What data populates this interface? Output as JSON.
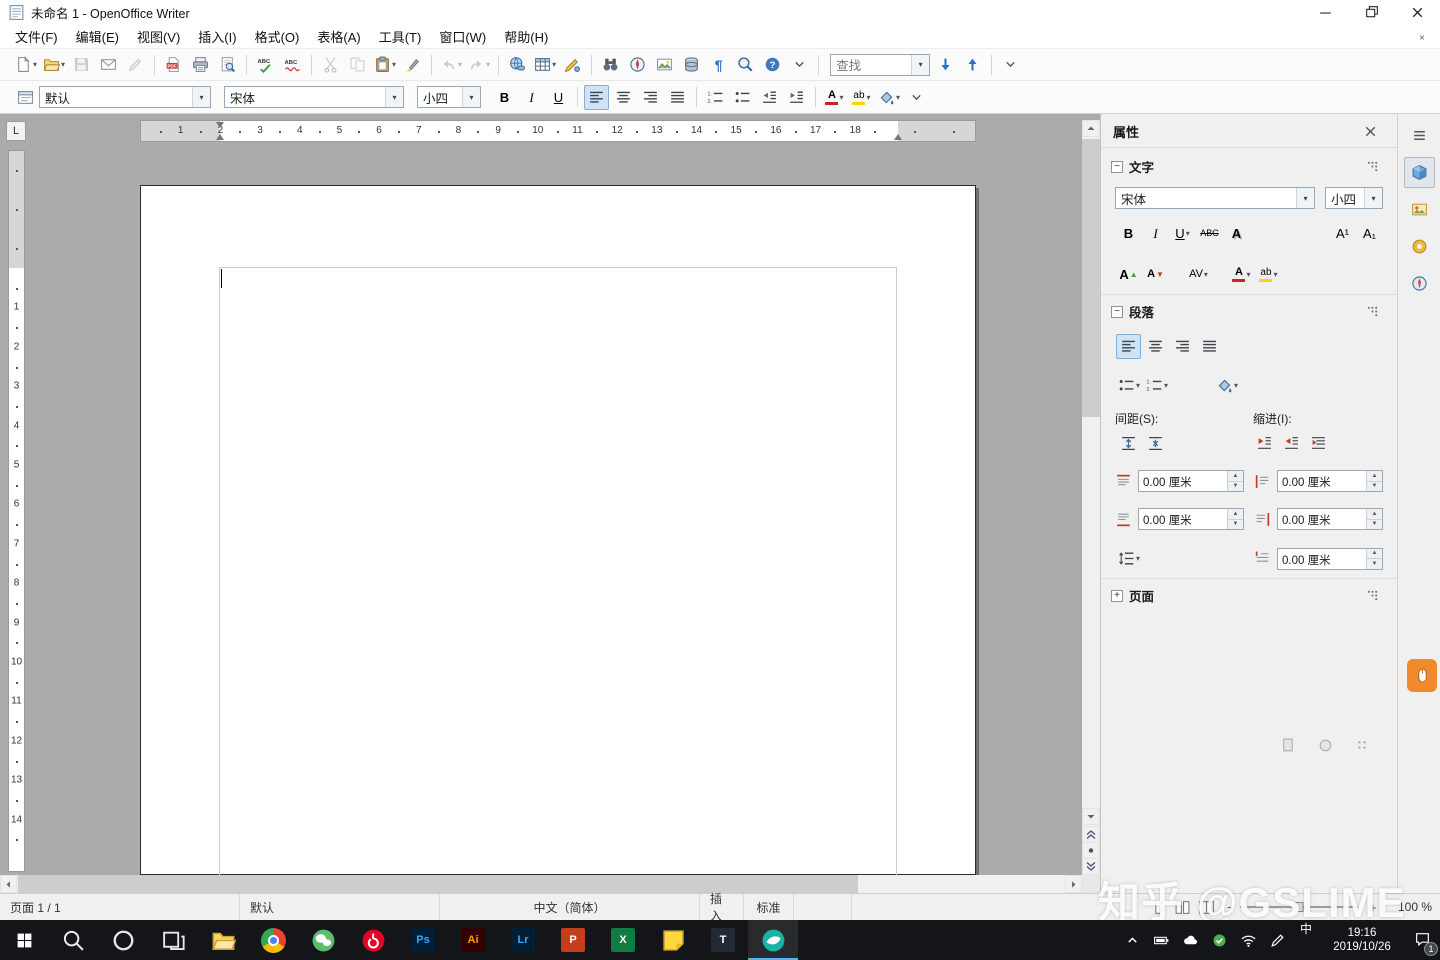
{
  "titlebar": {
    "title": "未命名 1 - OpenOffice Writer"
  },
  "menubar": {
    "items": [
      "文件(F)",
      "编辑(E)",
      "视图(V)",
      "插入(I)",
      "格式(O)",
      "表格(A)",
      "工具(T)",
      "窗口(W)",
      "帮助(H)"
    ]
  },
  "standard_toolbar": {
    "find_placeholder": "查找",
    "buttons": [
      {
        "name": "new-document-button",
        "glyph": "newdoc",
        "dropdown": true
      },
      {
        "name": "open-button",
        "glyph": "open",
        "dropdown": true
      },
      {
        "name": "save-button",
        "glyph": "save",
        "disabled": true
      },
      {
        "name": "email-document-button",
        "glyph": "email"
      },
      {
        "name": "edit-file-button",
        "glyph": "editfile",
        "disabled": true
      },
      {
        "sep": true
      },
      {
        "name": "export-pdf-button",
        "glyph": "pdf"
      },
      {
        "name": "print-button",
        "glyph": "print"
      },
      {
        "name": "page-preview-button",
        "glyph": "preview"
      },
      {
        "sep": true
      },
      {
        "name": "spelling-button",
        "glyph": "spell"
      },
      {
        "name": "autospellcheck-button",
        "glyph": "autospell"
      },
      {
        "sep": true
      },
      {
        "name": "cut-button",
        "glyph": "cut",
        "disabled": true
      },
      {
        "name": "copy-button",
        "glyph": "copy",
        "disabled": true
      },
      {
        "name": "paste-button",
        "glyph": "paste",
        "dropdown": true
      },
      {
        "name": "format-paintbrush-button",
        "glyph": "brush"
      },
      {
        "sep": true
      },
      {
        "name": "undo-button",
        "glyph": "undo",
        "dropdown": true,
        "disabled": true
      },
      {
        "name": "redo-button",
        "glyph": "redo",
        "dropdown": true,
        "disabled": true
      },
      {
        "sep": true
      },
      {
        "name": "hyperlink-button",
        "glyph": "hyperlink"
      },
      {
        "name": "table-button",
        "glyph": "table",
        "dropdown": true
      },
      {
        "name": "draw-functions-button",
        "glyph": "draw"
      },
      {
        "sep": true
      },
      {
        "name": "find-replace-button",
        "glyph": "binoculars"
      },
      {
        "name": "navigator-button",
        "glyph": "navigator"
      },
      {
        "name": "gallery-button",
        "glyph": "gallery"
      },
      {
        "name": "data-sources-button",
        "glyph": "datasource"
      },
      {
        "name": "formatting-marks-button",
        "glyph": "pilcrow"
      },
      {
        "name": "zoom-button",
        "glyph": "zoom"
      },
      {
        "name": "help-button",
        "glyph": "help"
      },
      {
        "name": "toolbar-overflow-button",
        "glyph": "chevdown"
      },
      {
        "sep": true
      }
    ]
  },
  "formatting_toolbar": {
    "style_value": "默认",
    "font_value": "宋体",
    "size_value": "小四",
    "buttons": [
      {
        "name": "bold-button",
        "glyph": "bold"
      },
      {
        "name": "italic-button",
        "glyph": "italic"
      },
      {
        "name": "underline-button",
        "glyph": "underline"
      },
      {
        "sep": true
      },
      {
        "name": "align-left-button",
        "glyph": "alignleft",
        "active": true
      },
      {
        "name": "align-center-button",
        "glyph": "aligncenter"
      },
      {
        "name": "align-right-button",
        "glyph": "alignright"
      },
      {
        "name": "align-justify-button",
        "glyph": "alignjustify"
      },
      {
        "sep": true
      },
      {
        "name": "numbering-button",
        "glyph": "numlist"
      },
      {
        "name": "bullets-button",
        "glyph": "bullist"
      },
      {
        "name": "decrease-indent-button",
        "glyph": "outdent"
      },
      {
        "name": "increase-indent-button",
        "glyph": "indent"
      },
      {
        "sep": true
      },
      {
        "name": "font-color-button",
        "glyph": "fontcolor",
        "dropdown": true
      },
      {
        "name": "highlighting-button",
        "glyph": "highlight",
        "dropdown": true
      },
      {
        "name": "background-color-button",
        "glyph": "bgcolor",
        "dropdown": true
      },
      {
        "name": "toolbar-overflow-button",
        "glyph": "chevdown"
      }
    ]
  },
  "ruler": {
    "h_numbers": [
      1,
      2,
      3,
      4,
      5,
      6,
      7,
      8,
      9,
      10,
      11,
      12,
      13,
      14,
      15,
      16,
      17,
      18
    ],
    "v_numbers": [
      1,
      2,
      3,
      4,
      5,
      6,
      7,
      8,
      9,
      10,
      11,
      12,
      13,
      14
    ],
    "tabstop_label": "L"
  },
  "sidebar": {
    "title": "属性",
    "character": {
      "title": "文字",
      "font_value": "宋体",
      "size_value": "小四",
      "row1": [
        {
          "name": "bold-button",
          "glyph": "bold"
        },
        {
          "name": "italic-button",
          "glyph": "italic"
        },
        {
          "name": "underline-button",
          "glyph": "underline",
          "dropdown": true
        },
        {
          "name": "strikethrough-button",
          "glyph": "strike"
        },
        {
          "name": "shadow-button",
          "glyph": "shadowA"
        }
      ],
      "row1_right": [
        {
          "name": "superscript-button",
          "glyph": "sup"
        },
        {
          "name": "subscript-button",
          "glyph": "sub"
        }
      ],
      "row2": [
        {
          "name": "increase-font-size-button",
          "glyph": "fontup"
        },
        {
          "name": "decrease-font-size-button",
          "glyph": "fontdown"
        }
      ],
      "row2_spacing": [
        {
          "name": "character-spacing-button",
          "glyph": "spacingAV",
          "dropdown": true
        }
      ],
      "row2_color": [
        {
          "name": "font-color-button",
          "glyph": "fontcolor",
          "dropdown": true
        },
        {
          "name": "highlighting-button",
          "glyph": "highlight",
          "dropdown": true
        }
      ]
    },
    "paragraph": {
      "title": "段落",
      "spacing_label": "间距(S):",
      "indent_label": "缩进(I):",
      "align_row": [
        {
          "name": "align-left-button",
          "glyph": "alignleft",
          "active": true
        },
        {
          "name": "align-center-button",
          "glyph": "aligncenter"
        },
        {
          "name": "align-right-button",
          "glyph": "alignright"
        },
        {
          "name": "align-justify-button",
          "glyph": "alignjustify"
        }
      ],
      "list_row": [
        {
          "name": "bullets-button",
          "glyph": "bullist",
          "dropdown": true
        },
        {
          "name": "numbering-button",
          "glyph": "numlist",
          "dropdown": true
        }
      ],
      "bg_row": [
        {
          "name": "paragraph-background-button",
          "glyph": "bgcolor",
          "dropdown": true
        }
      ],
      "spacing_buttons": [
        {
          "name": "increase-paragraph-spacing-button",
          "glyph": "incspace"
        },
        {
          "name": "decrease-paragraph-spacing-button",
          "glyph": "decspace"
        }
      ],
      "indent_buttons": [
        {
          "name": "increase-indent-button",
          "glyph": "indent2"
        },
        {
          "name": "decrease-indent-button",
          "glyph": "outdent2"
        },
        {
          "name": "hanging-indent-button",
          "glyph": "hangindent"
        }
      ],
      "above_spacing_value": "0.00 厘米",
      "below_spacing_value": "0.00 厘米",
      "before_indent_value": "0.00 厘米",
      "after_indent_value": "0.00 厘米",
      "first_line_indent_value": "0.00 厘米"
    },
    "page": {
      "title": "页面"
    }
  },
  "tabstrip": [
    {
      "name": "sidebar-settings-button",
      "glyph": "menu"
    },
    {
      "name": "properties-tab",
      "glyph": "cube",
      "active": true
    },
    {
      "name": "gallery-tab",
      "glyph": "galleryTab"
    },
    {
      "name": "styles-tab",
      "glyph": "stylesTab"
    },
    {
      "name": "navigator-tab",
      "glyph": "compass"
    }
  ],
  "statusbar": {
    "page": "页面 1 / 1",
    "style": "默认",
    "language": "中文（简体）",
    "insert_mode": "插入",
    "selection_mode": "标准",
    "zoom_value": "100 %"
  },
  "watermark": {
    "text": "知乎 @GSLIME"
  },
  "taskbar": {
    "apps": [
      {
        "name": "taskbar-search",
        "kind": "search"
      },
      {
        "name": "taskbar-cortana",
        "kind": "cortana"
      },
      {
        "name": "taskbar-task-view",
        "kind": "taskview"
      },
      {
        "name": "taskbar-file-explorer",
        "kind": "explorer"
      },
      {
        "name": "taskbar-chrome",
        "kind": "chrome"
      },
      {
        "name": "taskbar-wechat",
        "kind": "wechat"
      },
      {
        "name": "taskbar-netease-music",
        "kind": "netease"
      },
      {
        "name": "taskbar-photoshop",
        "kind": "adobe",
        "label": "Ps",
        "fg": "#31a8ff",
        "bg": "#001e36"
      },
      {
        "name": "taskbar-illustrator",
        "kind": "adobe",
        "label": "Ai",
        "fg": "#ff9a00",
        "bg": "#330000"
      },
      {
        "name": "taskbar-lightroom",
        "kind": "adobe",
        "label": "Lr",
        "fg": "#31a8ff",
        "bg": "#001e36"
      },
      {
        "name": "taskbar-powerpoint",
        "kind": "office",
        "label": "P",
        "bg": "#c43e1c"
      },
      {
        "name": "taskbar-excel",
        "kind": "office",
        "label": "X",
        "bg": "#107c41"
      },
      {
        "name": "taskbar-sticky-notes",
        "kind": "notes"
      },
      {
        "name": "taskbar-t-app",
        "kind": "office",
        "label": "T",
        "bg": "#232a36"
      },
      {
        "name": "taskbar-active-app",
        "kind": "teal",
        "active": true
      }
    ],
    "tray": {
      "icons": [
        {
          "name": "hidden-icons-button",
          "kind": "chevron"
        },
        {
          "name": "battery-icon",
          "kind": "battery"
        },
        {
          "name": "onedrive-icon",
          "kind": "cloud"
        },
        {
          "name": "security-icon",
          "kind": "shield"
        },
        {
          "name": "network-icon",
          "kind": "wifi"
        },
        {
          "name": "pen-input-icon",
          "kind": "pen"
        }
      ],
      "ime": "中",
      "time": "19:16",
      "date": "2019/10/26",
      "notification_count": "1"
    }
  }
}
